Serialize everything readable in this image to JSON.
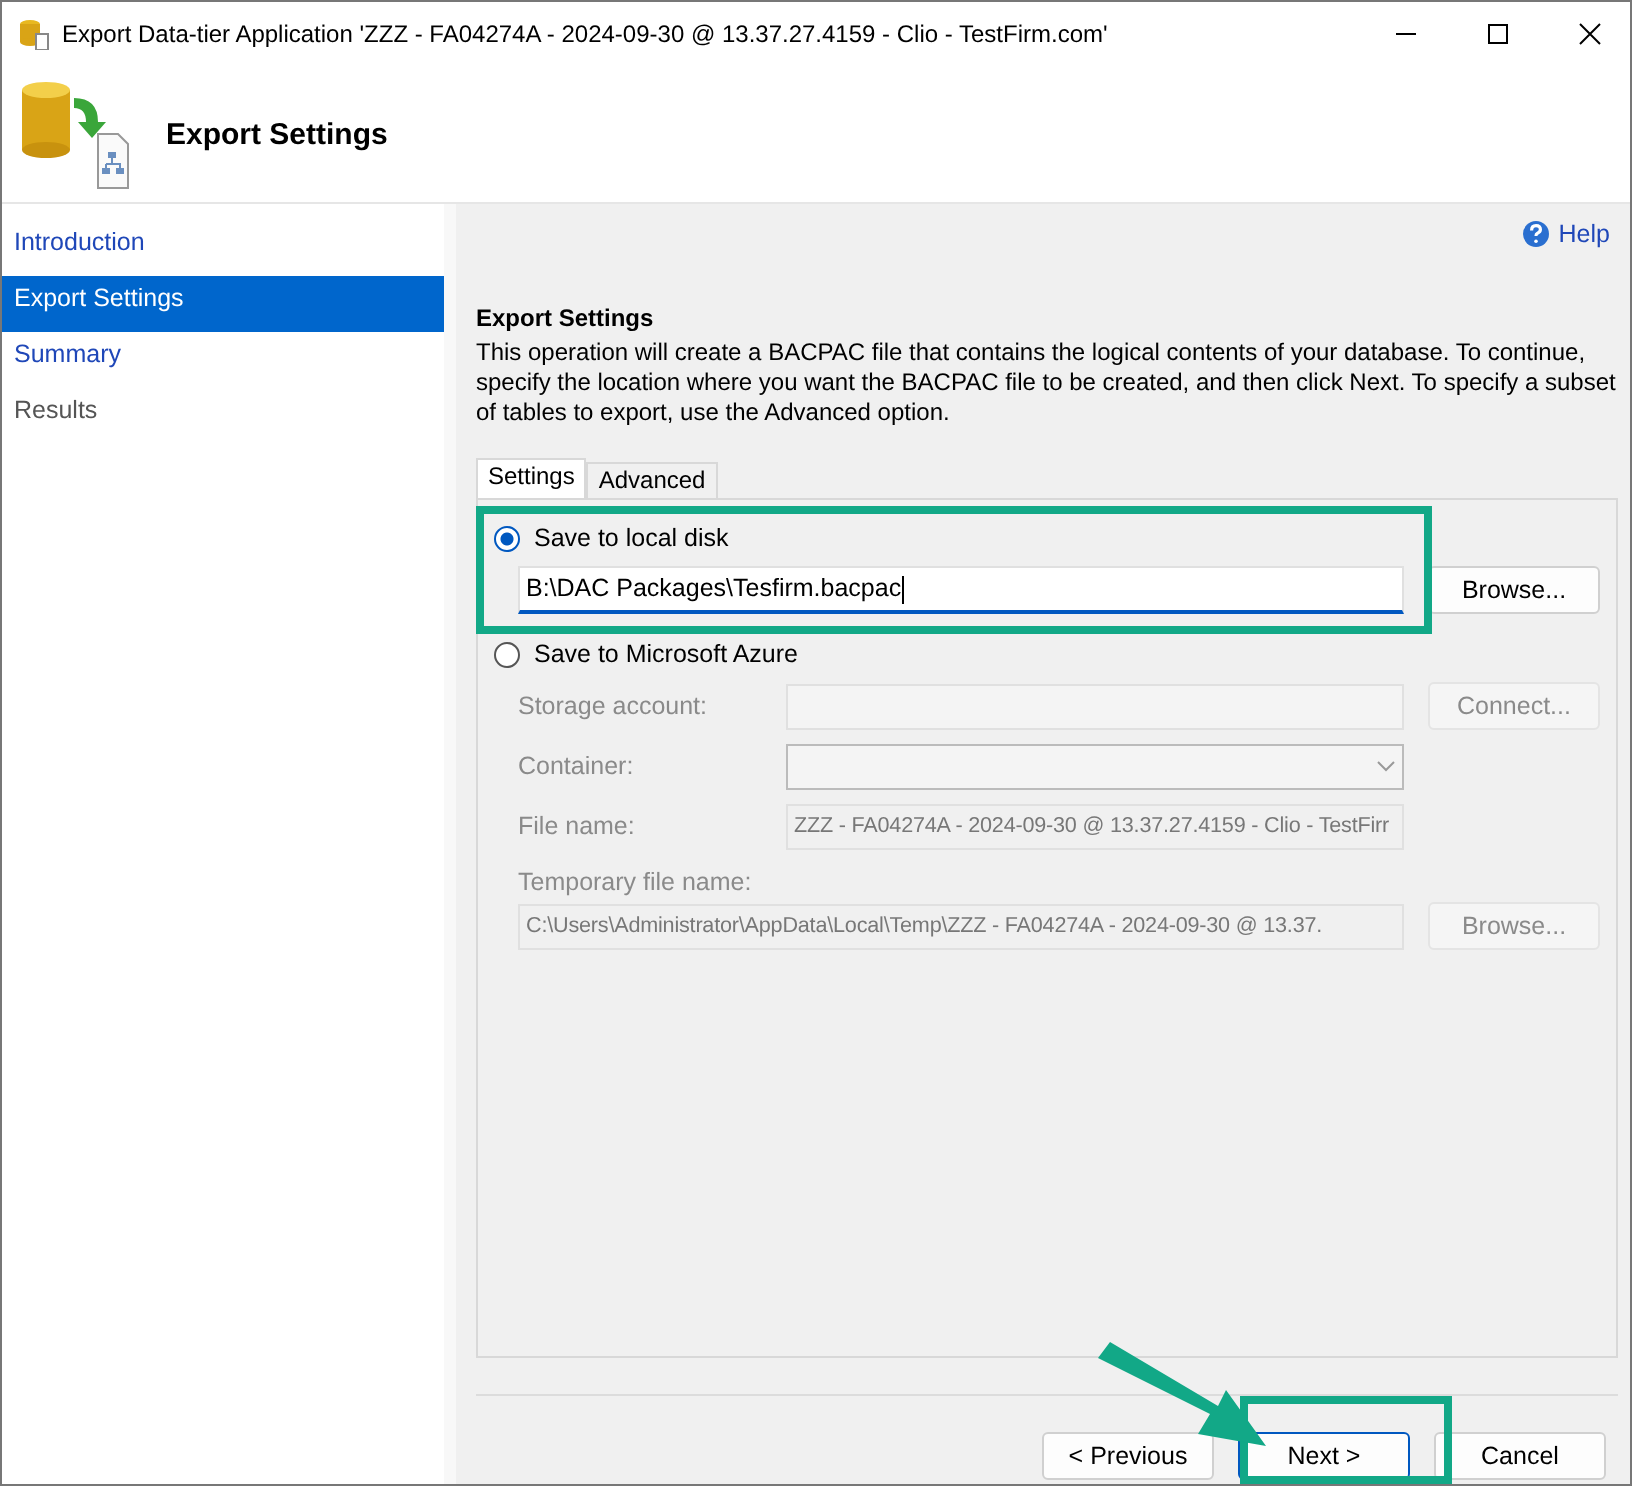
{
  "window": {
    "title": "Export Data-tier Application 'ZZZ - FA04274A - 2024-09-30 @ 13.37.27.4159 - Clio - TestFirm.com'"
  },
  "header": {
    "title": "Export Settings"
  },
  "sidebar": {
    "items": [
      {
        "label": "Introduction",
        "selected": false,
        "disabled": false
      },
      {
        "label": "Export Settings",
        "selected": true,
        "disabled": false
      },
      {
        "label": "Summary",
        "selected": false,
        "disabled": false
      },
      {
        "label": "Results",
        "selected": false,
        "disabled": true
      }
    ]
  },
  "help": {
    "label": "Help"
  },
  "section": {
    "heading": "Export Settings",
    "description": "This operation will create a BACPAC file that contains the logical contents of your database. To continue, specify the location where you want the BACPAC file to be created, and then click Next. To specify a subset of tables to export, use the Advanced option."
  },
  "tabs": [
    {
      "label": "Settings",
      "selected": true
    },
    {
      "label": "Advanced",
      "selected": false
    }
  ],
  "local": {
    "label": "Save to local disk",
    "selected": true,
    "path": "B:\\DAC Packages\\Tesfirm.bacpac",
    "browse": "Browse..."
  },
  "azure": {
    "label": "Save to Microsoft Azure",
    "selected": false,
    "storage_label": "Storage account:",
    "connect": "Connect...",
    "container_label": "Container:",
    "file_label": "File name:",
    "file_value": "ZZZ - FA04274A - 2024-09-30 @ 13.37.27.4159 - Clio - TestFirr",
    "temp_label": "Temporary file name:",
    "temp_value": "C:\\Users\\Administrator\\AppData\\Local\\Temp\\ZZZ - FA04274A - 2024-09-30 @ 13.37.",
    "temp_browse": "Browse..."
  },
  "buttons": [
    {
      "label": "< Previous",
      "default": false
    },
    {
      "label": "Next >",
      "default": true
    },
    {
      "label": "Cancel",
      "default": false
    }
  ]
}
